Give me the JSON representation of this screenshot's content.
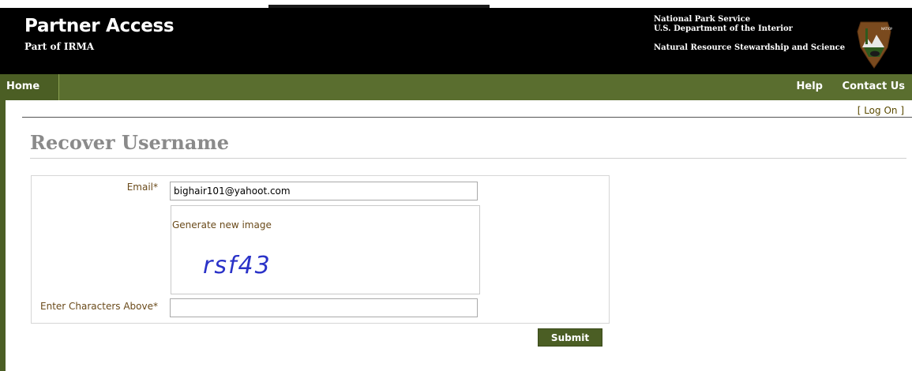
{
  "header": {
    "title": "Partner Access",
    "subtitle": "Part of IRMA",
    "agency_line1": "National Park Service",
    "agency_line2": "U.S. Department of the Interior",
    "agency_line3": "Natural Resource Stewardship and Science",
    "logo_icon": "nps-arrowhead-logo-icon"
  },
  "nav": {
    "home": "Home",
    "help": "Help",
    "contact": "Contact Us"
  },
  "auth": {
    "logon_label": "[ Log On ]"
  },
  "page": {
    "title": "Recover Username"
  },
  "form": {
    "email_label": "Email*",
    "email_value": "bighair101@yahoot.com",
    "generate_link": "Generate new image",
    "captcha_text": "rsf43",
    "chars_label": "Enter Characters Above*",
    "chars_value": "",
    "submit_label": "Submit"
  },
  "colors": {
    "header_bg": "#000000",
    "nav_bg": "#5a6e2f",
    "accent_green": "#4b5e24",
    "captcha_blue": "#2a32c8",
    "label_brown": "#6a4a1a"
  }
}
